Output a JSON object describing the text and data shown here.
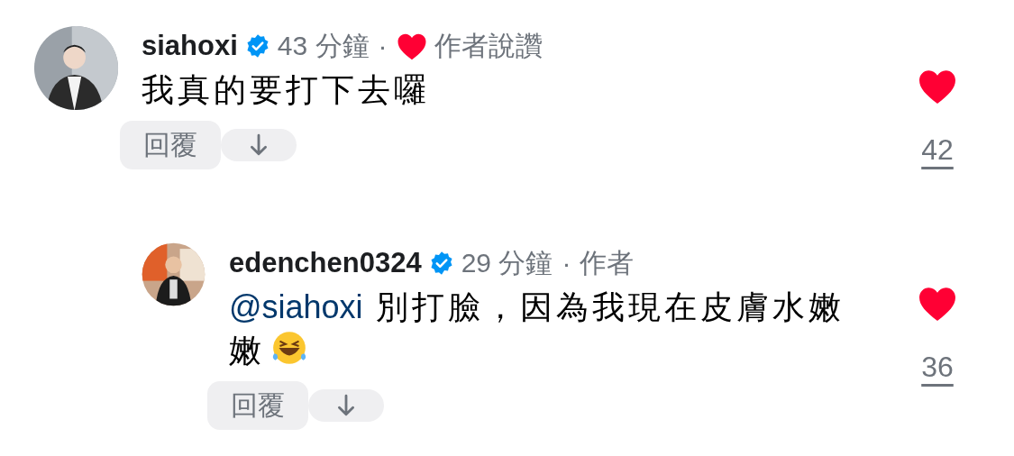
{
  "comments": [
    {
      "username": "siahoxi",
      "verified": true,
      "time": "43 分鐘",
      "separator": "·",
      "author_liked": true,
      "author_label": "作者說讚",
      "text": "我真的要打下去囉",
      "reply_label": "回覆",
      "liked": true,
      "like_count": "42",
      "replies": [
        {
          "username": "edenchen0324",
          "verified": true,
          "time": "29 分鐘",
          "separator": "·",
          "author_liked": false,
          "author_label": "作者",
          "mention": "@siahoxi",
          "text": "別打臉，因為我現在皮膚水嫩嫩",
          "emoji": true,
          "reply_label": "回覆",
          "liked": true,
          "like_count": "36"
        }
      ]
    }
  ]
}
